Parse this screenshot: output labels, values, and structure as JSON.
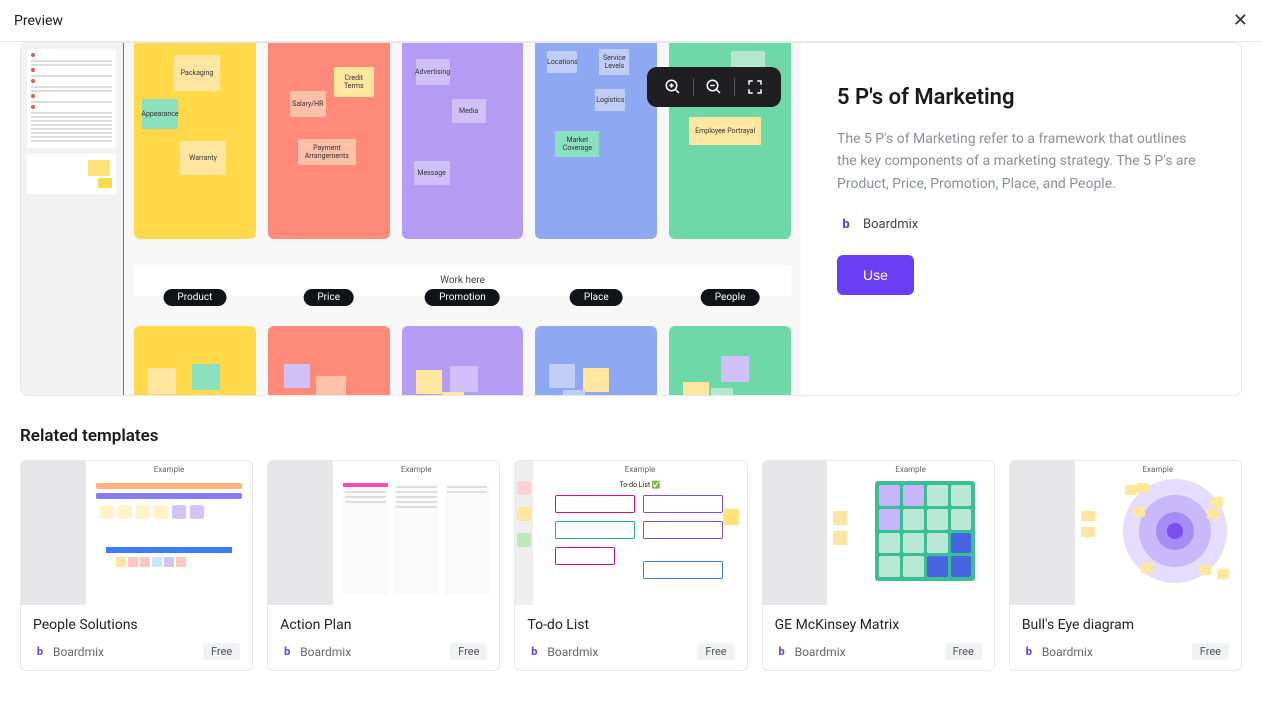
{
  "header": {
    "title": "Preview"
  },
  "template": {
    "title": "5 P's of Marketing",
    "description": "The 5 P's of Marketing refer to a framework that outlines the key components of a marketing strategy. The 5 P's are Product, Price, Promotion, Place, and People.",
    "author": "Boardmix",
    "use_label": "Use",
    "work_here_label": "Work here",
    "columns": [
      {
        "key": "product",
        "label": "Product",
        "notes_top": [
          "Packaging",
          "Appearance",
          "Warranty"
        ]
      },
      {
        "key": "price",
        "label": "Price",
        "notes_top": [
          "Credit Terms",
          "Salary/HR",
          "Payment Arrangements"
        ]
      },
      {
        "key": "promotion",
        "label": "Promotion",
        "notes_top": [
          "Advertising",
          "Media",
          "Message"
        ]
      },
      {
        "key": "place",
        "label": "Place",
        "notes_top": [
          "Locations",
          "Service Levels",
          "Logistics",
          "Market Coverage"
        ]
      },
      {
        "key": "people",
        "label": "People",
        "notes_top": [
          "Employee Portrayal"
        ]
      }
    ]
  },
  "related": {
    "heading": "Related templates",
    "items": [
      {
        "title": "People Solutions",
        "author": "Boardmix",
        "price": "Free",
        "example_label": "Example"
      },
      {
        "title": "Action Plan",
        "author": "Boardmix",
        "price": "Free",
        "example_label": "Example"
      },
      {
        "title": "To-do List",
        "author": "Boardmix",
        "price": "Free",
        "example_label": "Example",
        "preview_title": "To-do List ✅"
      },
      {
        "title": "GE McKinsey Matrix",
        "author": "Boardmix",
        "price": "Free",
        "example_label": "Example"
      },
      {
        "title": "Bull's Eye diagram",
        "author": "Boardmix",
        "price": "Free",
        "example_label": "Example"
      }
    ]
  }
}
